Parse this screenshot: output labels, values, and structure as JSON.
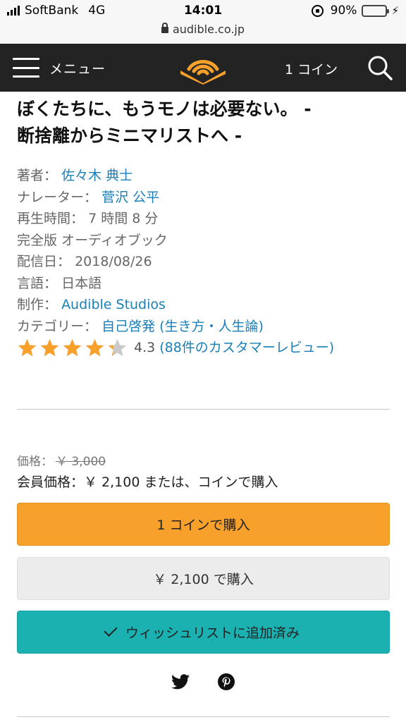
{
  "status_bar": {
    "carrier": "SoftBank",
    "network": "4G",
    "time": "14:01",
    "battery": "90%",
    "battery_level": 0.9,
    "url": "audible.co.jp"
  },
  "header": {
    "menu_label": "メニュー",
    "coins_label": "1 コイン",
    "brand_color": "#f7a02b",
    "background": "#232323"
  },
  "product": {
    "title_line1": "ぼくたちに、もうモノは必要ない。 -",
    "title_line2": "断捨離からミニマリストへ -",
    "author_label": "著者：",
    "author": "佐々木 典士",
    "narrator_label": "ナレーター：",
    "narrator": "菅沢 公平",
    "length_label": "再生時間：",
    "length": "7 時間 8 分",
    "format": "完全版 オーディオブック",
    "release_label": "配信日：",
    "release_date": "2018/08/26",
    "language_label": "言語：",
    "language": "日本語",
    "publisher_label": "制作：",
    "publisher": "Audible Studios",
    "category_label": "カテゴリー：",
    "category": "自己啓発 (生き方・人生論)",
    "rating": 4.3,
    "rating_text": "4.3",
    "reviews_text": "(88件のカスタマーレビュー)"
  },
  "pricing": {
    "price_label": "価格：",
    "list_price": "￥ 3,000",
    "member_price_text": "会員価格：￥ 2,100 または、コインで購入"
  },
  "buttons": {
    "buy_with_coin": "1 コインで購入",
    "buy_with_cash": "￥ 2,100 で購入",
    "wishlist": "ウィッシュリストに追加済み"
  },
  "share": {
    "icons": [
      "twitter-icon",
      "pinterest-icon"
    ]
  },
  "colors": {
    "link": "#1a7fb7",
    "star": "#f7a02b",
    "wishlist_button": "#1bb1b1",
    "buy_button": "#f7a02b"
  }
}
